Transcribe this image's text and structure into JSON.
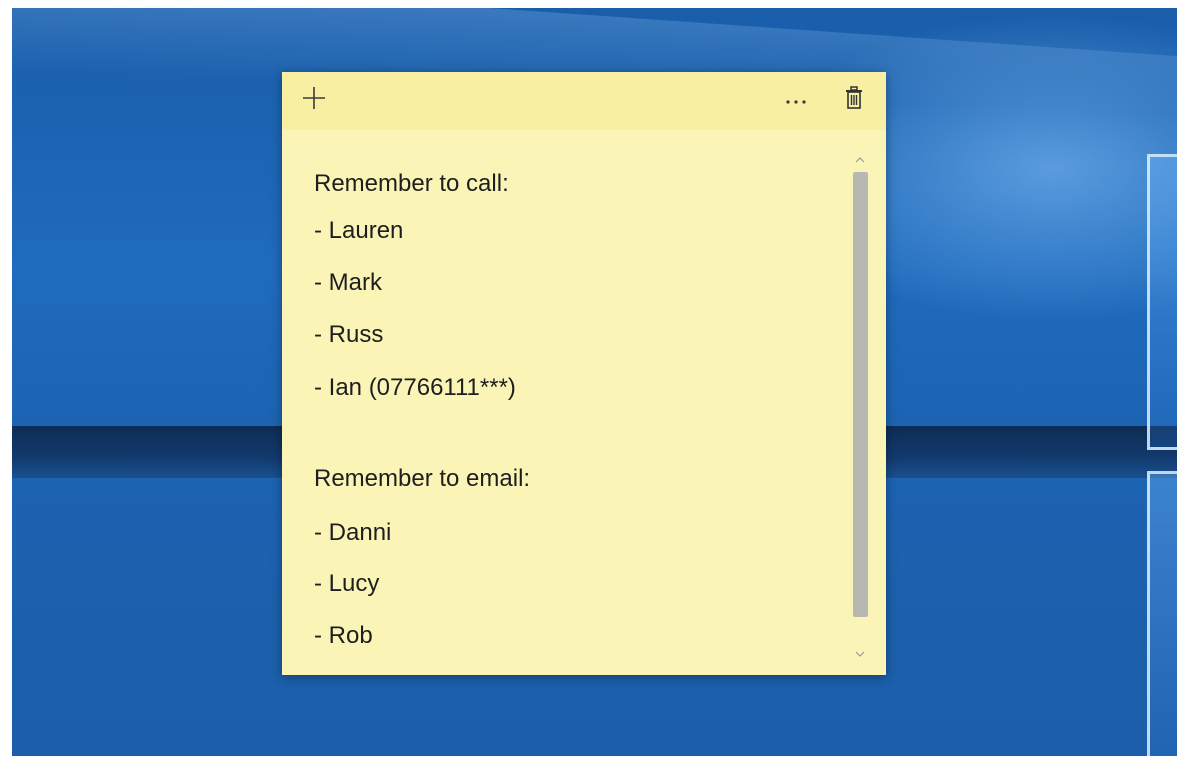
{
  "sticky_note": {
    "header": {
      "add_icon": "plus-icon",
      "menu_icon": "more-horizontal-icon",
      "delete_icon": "trash-icon"
    },
    "lines": [
      "Remember to call:",
      "- Lauren",
      "- Mark",
      "- Russ",
      "- Ian (07766111***)",
      "",
      "Remember to email:",
      "- Danni",
      "- Lucy",
      "- Rob"
    ],
    "colors": {
      "body": "#fbf4b7",
      "header": "#f8efa2",
      "text": "#1e1e1e",
      "scrollbar": "#b8b8b3"
    }
  },
  "desktop": {
    "wallpaper_color": "#1c64b3"
  }
}
